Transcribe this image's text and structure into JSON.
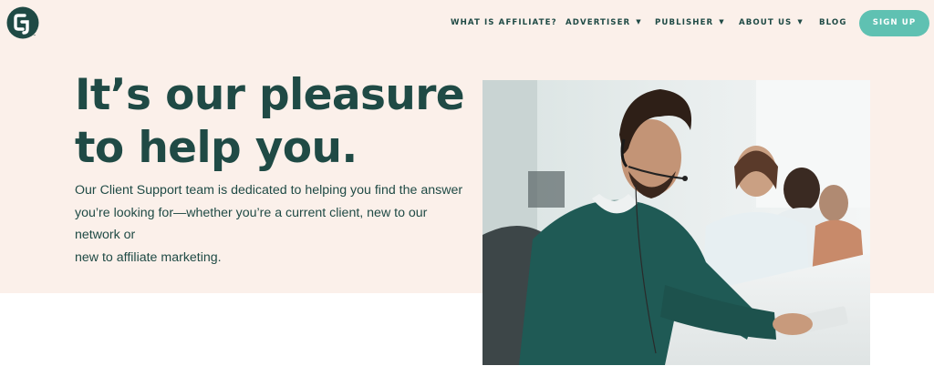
{
  "brand": {
    "logo_icon": "cj-logo-icon",
    "colors": {
      "primary_dark": "#1f4a45",
      "accent": "#5fc1b2",
      "hero_background": "#fbf0ea"
    }
  },
  "nav": {
    "items": [
      {
        "label": "WHAT IS AFFILIATE?",
        "has_dropdown": false
      },
      {
        "label": "ADVERTISER",
        "has_dropdown": true
      },
      {
        "label": "PUBLISHER",
        "has_dropdown": true
      },
      {
        "label": "ABOUT US",
        "has_dropdown": true
      },
      {
        "label": "BLOG",
        "has_dropdown": false
      }
    ],
    "signup_label": "SIGN UP",
    "dropdown_icon": "chevron-down-icon"
  },
  "hero": {
    "headline_line1": "It’s our pleasure",
    "headline_line2": "to help you.",
    "body_line1": "Our Client Support team is dedicated to helping you find the answer",
    "body_line2": "you’re looking for—whether you’re a current client, new to our network or",
    "body_line3": "new to affiliate marketing."
  }
}
